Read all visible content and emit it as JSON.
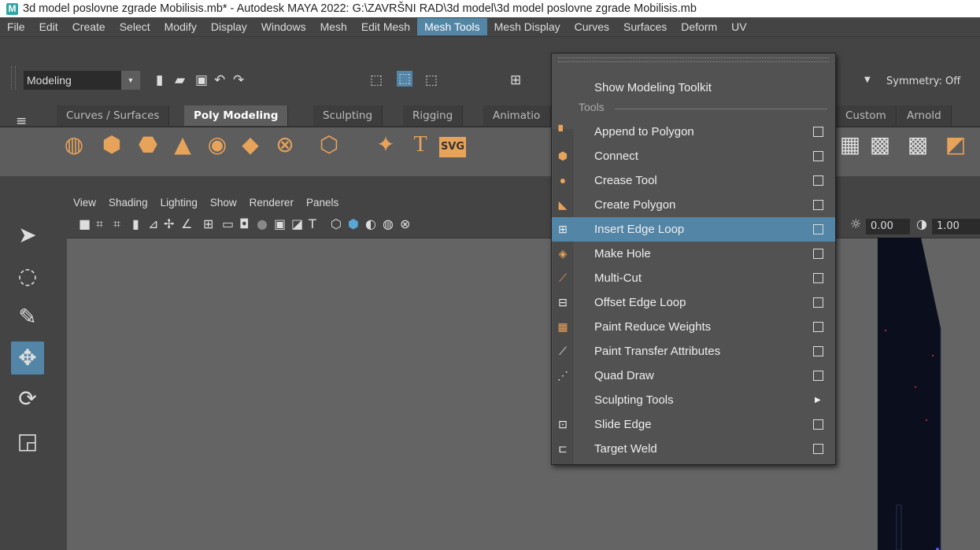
{
  "titlebar": {
    "logo": "M",
    "title": "3d model poslovne zgrade Mobilisis.mb* - Autodesk MAYA 2022: G:\\ZAVRŠNI RAD\\3d model\\3d model poslovne zgrade Mobilisis.mb"
  },
  "menubar": [
    "File",
    "Edit",
    "Create",
    "Select",
    "Modify",
    "Display",
    "Windows",
    "Mesh",
    "Edit Mesh",
    "Mesh Tools",
    "Mesh Display",
    "Curves",
    "Surfaces",
    "Deform",
    "UV"
  ],
  "statusline": {
    "mode": "Modeling",
    "symmetry": "Symmetry: Off"
  },
  "shelf_tabs": [
    "Curves / Surfaces",
    "Poly Modeling",
    "Sculpting",
    "Rigging",
    "Animatio",
    "Custom",
    "Arnold"
  ],
  "shelf_active": "Poly Modeling",
  "panel_menu": [
    "View",
    "Shading",
    "Lighting",
    "Show",
    "Renderer",
    "Panels"
  ],
  "panel_fields": {
    "exposure": "0.00",
    "gamma": "1.00"
  },
  "mesh_tools_menu": {
    "show_toolkit": "Show Modeling Toolkit",
    "section": "Tools",
    "items": [
      {
        "label": "Append to Polygon",
        "option_box": true
      },
      {
        "label": "Connect",
        "option_box": true
      },
      {
        "label": "Crease Tool",
        "option_box": true
      },
      {
        "label": "Create Polygon",
        "option_box": true
      },
      {
        "label": "Insert Edge Loop",
        "option_box": true
      },
      {
        "label": "Make Hole",
        "option_box": true
      },
      {
        "label": "Multi-Cut",
        "option_box": true
      },
      {
        "label": "Offset Edge Loop",
        "option_box": true
      },
      {
        "label": "Paint Reduce Weights",
        "option_box": true
      },
      {
        "label": "Paint Transfer Attributes",
        "option_box": true
      },
      {
        "label": "Quad Draw",
        "option_box": true
      },
      {
        "label": "Sculpting Tools",
        "option_box": false
      },
      {
        "label": "Slide Edge",
        "option_box": true
      },
      {
        "label": "Target Weld",
        "option_box": true
      }
    ],
    "highlighted": "Insert Edge Loop"
  },
  "colors": {
    "accent": "#5285a6",
    "shelf_icon": "#e8a35a"
  }
}
